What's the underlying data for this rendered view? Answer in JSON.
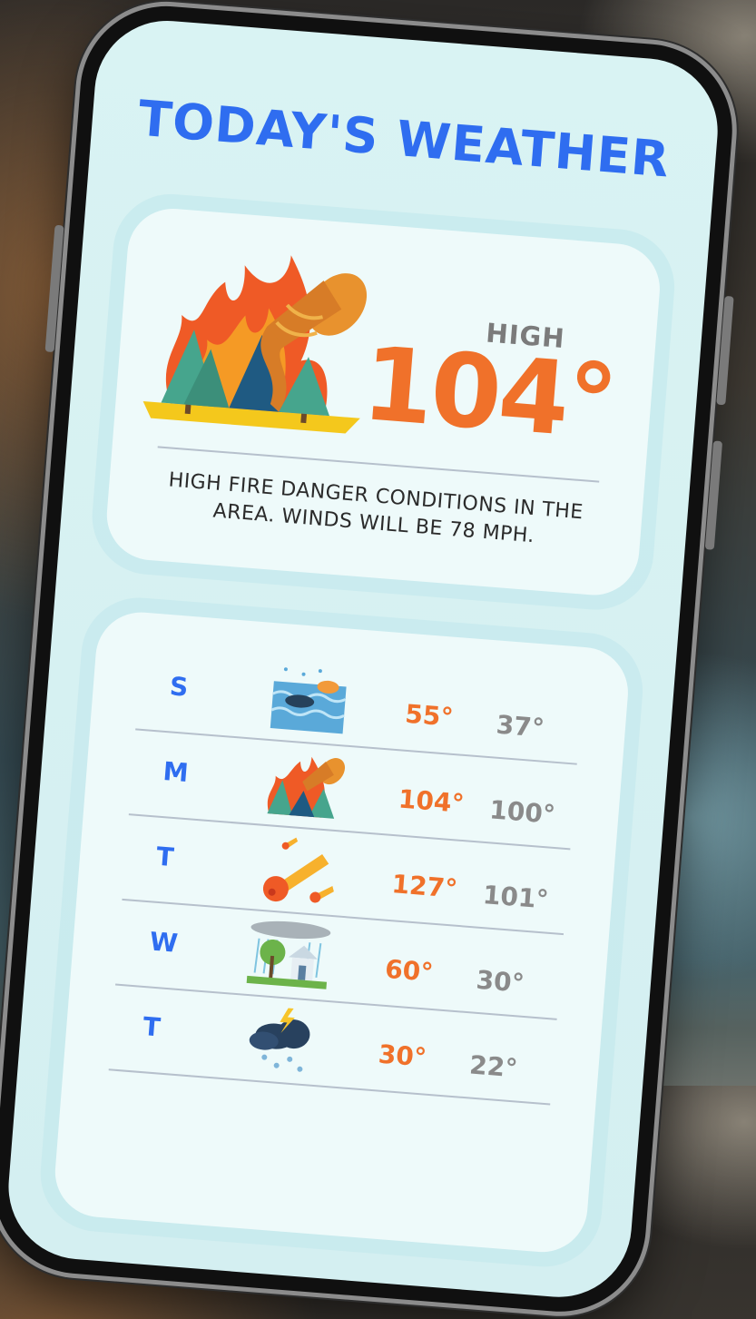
{
  "screen": {
    "title": "TODAY'S WEATHER"
  },
  "today": {
    "icon": "wildfire-tornado-icon",
    "high_label": "HIGH",
    "high_value": "104°",
    "description": "HIGH FIRE DANGER CONDITIONS IN THE AREA. WINDS WILL BE 78 MPH."
  },
  "forecast": [
    {
      "day": "S",
      "icon": "flood-icon",
      "high": "55°",
      "low": "37°"
    },
    {
      "day": "M",
      "icon": "wildfire-tornado-icon",
      "high": "104°",
      "low": "100°"
    },
    {
      "day": "T",
      "icon": "meteor-icon",
      "high": "127°",
      "low": "101°"
    },
    {
      "day": "W",
      "icon": "storm-house-icon",
      "high": "60°",
      "low": "30°"
    },
    {
      "day": "T",
      "icon": "thunder-snow-icon",
      "high": "30°",
      "low": "22°"
    }
  ],
  "colors": {
    "accent_blue": "#2f6df0",
    "high_orange": "#f0712a",
    "low_gray": "#8a8a8a",
    "screen_bg": "#d9f3f3"
  }
}
